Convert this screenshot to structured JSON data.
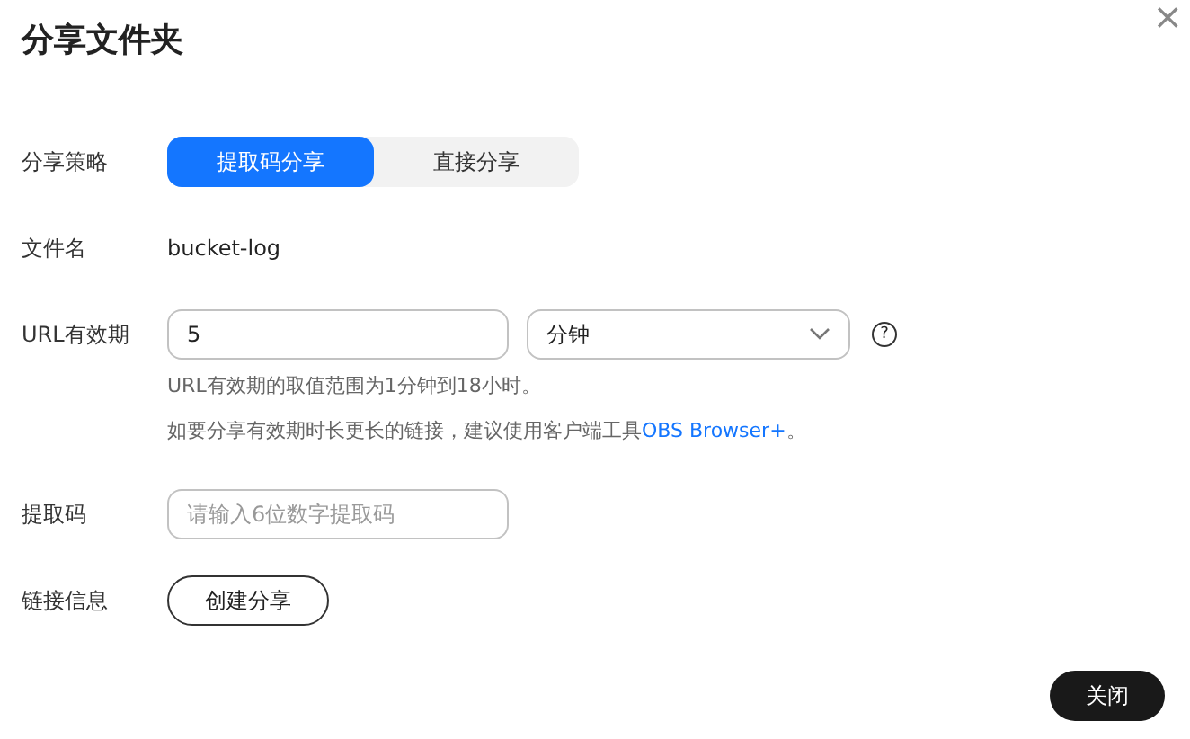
{
  "dialog": {
    "title": "分享文件夹",
    "close": "×"
  },
  "strategy": {
    "label": "分享策略",
    "options": [
      {
        "label": "提取码分享",
        "selected": true
      },
      {
        "label": "直接分享",
        "selected": false
      }
    ]
  },
  "file_name": {
    "label": "文件名",
    "value": "bucket-log"
  },
  "url_validity": {
    "label": "URL有效期",
    "value": "5",
    "unit": "分钟",
    "help": "?",
    "hint": "URL有效期的取值范围为1分钟到18小时。",
    "hint2": "如要分享有效期时长更长的链接，建议使用客户端工具",
    "link": "OBS Browser+",
    "hint2_end": "。"
  },
  "code": {
    "label": "提取码",
    "placeholder": "请输入6位数字提取码"
  },
  "link_info": {
    "label": "链接信息",
    "button": "创建分享"
  },
  "footer": {
    "button": "关闭"
  }
}
